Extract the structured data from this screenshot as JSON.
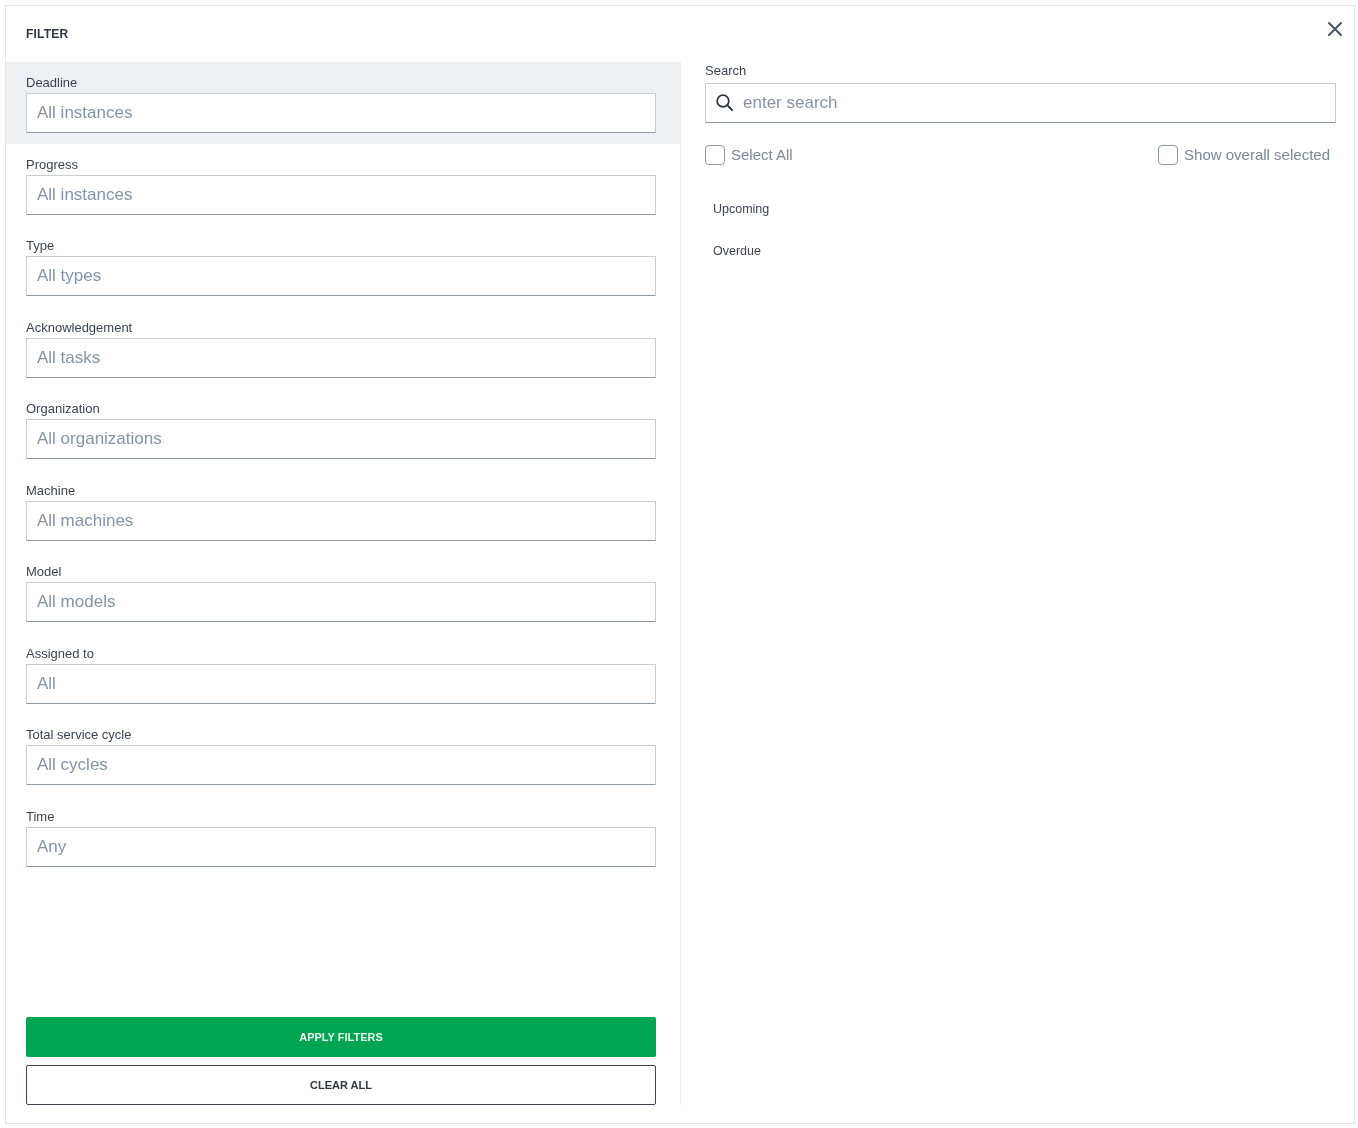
{
  "header": {
    "title": "FILTER"
  },
  "filters": [
    {
      "label": "Deadline",
      "placeholder": "All instances",
      "selected": true
    },
    {
      "label": "Progress",
      "placeholder": "All instances",
      "selected": false
    },
    {
      "label": "Type",
      "placeholder": "All types",
      "selected": false
    },
    {
      "label": "Acknowledgement",
      "placeholder": "All tasks",
      "selected": false
    },
    {
      "label": "Organization",
      "placeholder": "All organizations",
      "selected": false
    },
    {
      "label": "Machine",
      "placeholder": "All machines",
      "selected": false
    },
    {
      "label": "Model",
      "placeholder": "All models",
      "selected": false
    },
    {
      "label": "Assigned to",
      "placeholder": "All",
      "selected": false
    },
    {
      "label": "Total service cycle",
      "placeholder": "All cycles",
      "selected": false
    },
    {
      "label": "Time",
      "placeholder": "Any",
      "selected": false
    }
  ],
  "buttons": [
    {
      "label": "APPLY FILTERS",
      "kind": "primary"
    },
    {
      "label": "CLEAR ALL",
      "kind": "outline"
    }
  ],
  "options_panel": {
    "search": {
      "label": "Search",
      "placeholder": "enter search"
    },
    "checkboxes": [
      {
        "label": "Select All",
        "checked": false
      },
      {
        "label": "Show overall selected",
        "checked": false
      }
    ],
    "options": [
      {
        "label": "Upcoming"
      },
      {
        "label": "Overdue"
      }
    ]
  }
}
